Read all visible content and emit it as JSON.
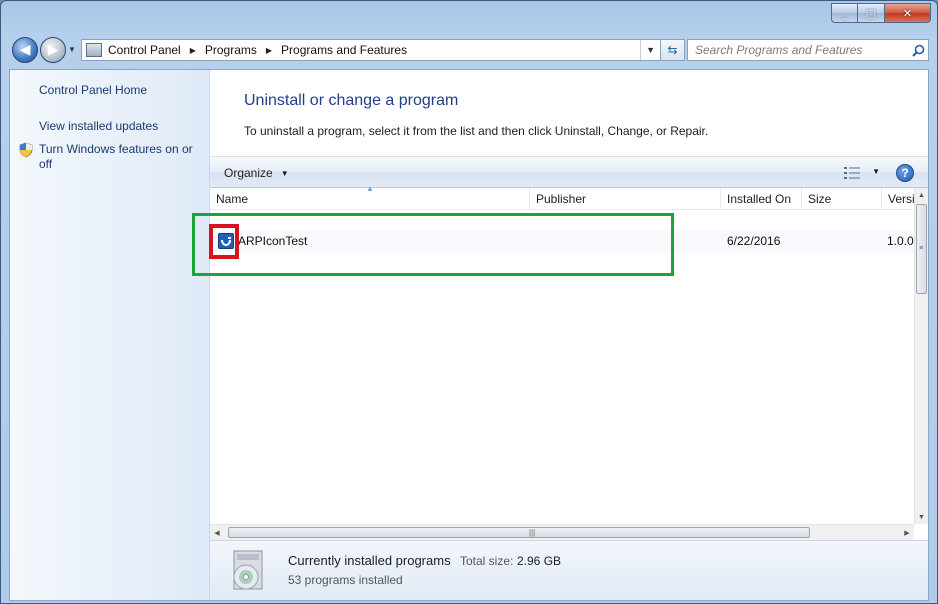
{
  "window": {
    "caption": {
      "minimize": "_",
      "maximize": "□",
      "close": "✕"
    }
  },
  "address_bar": {
    "back_glyph": "◀",
    "forward_glyph": "▶",
    "breadcrumb": [
      "Control Panel",
      "Programs",
      "Programs and Features"
    ],
    "search_placeholder": "Search Programs and Features"
  },
  "left_pane": {
    "links": [
      "Control Panel Home",
      "View installed updates",
      "Turn Windows features on or off"
    ]
  },
  "main": {
    "title": "Uninstall or change a program",
    "description": "To uninstall a program, select it from the list and then click Uninstall, Change, or Repair."
  },
  "toolbar": {
    "organize_label": "Organize",
    "help_label": "?"
  },
  "columns": [
    "Name",
    "Publisher",
    "Installed On",
    "Size",
    "Versi"
  ],
  "programs": [
    {
      "name": "ARPIconTest",
      "publisher": "",
      "installed_on": "6/22/2016",
      "size": "",
      "version": "1.0.0"
    }
  ],
  "details": {
    "title": "Currently installed programs",
    "size_label": "Total size:",
    "size_value": "2.96 GB",
    "count": "53 programs installed"
  },
  "colors": {
    "highlight_green": "#1ea23a",
    "highlight_red": "#d7141e",
    "link_blue": "#1d3a72",
    "title_blue": "#1e3f8a"
  },
  "icons": [
    "back-arrow-icon",
    "forward-arrow-icon",
    "control-panel-icon",
    "refresh-icon",
    "search-icon",
    "shield-icon",
    "view-options-icon",
    "help-icon",
    "app-icon",
    "installed-programs-cd-icon"
  ]
}
